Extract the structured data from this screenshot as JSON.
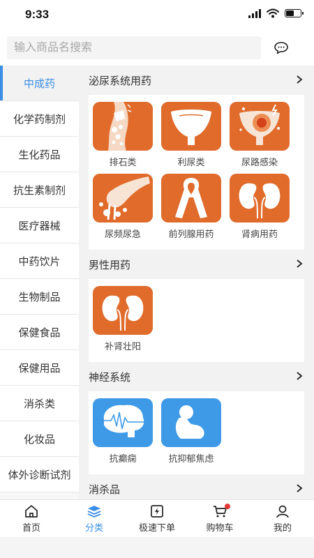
{
  "status": {
    "time": "9:33",
    "battery_level": 0.6
  },
  "search": {
    "placeholder": "输入商品名搜索",
    "value": ""
  },
  "header": {
    "message_icon": "chat-bubble-icon"
  },
  "sidebar": {
    "items": [
      {
        "label": "中成药",
        "active": true
      },
      {
        "label": "化学药制剂"
      },
      {
        "label": "生化药品"
      },
      {
        "label": "抗生素制剂"
      },
      {
        "label": "医疗器械"
      },
      {
        "label": "中药饮片"
      },
      {
        "label": "生物制品"
      },
      {
        "label": "保健食品"
      },
      {
        "label": "保健用品"
      },
      {
        "label": "消杀类"
      },
      {
        "label": "化妆品"
      },
      {
        "label": "体外诊断试剂"
      }
    ]
  },
  "sections": [
    {
      "title": "泌尿系统用药",
      "items": [
        {
          "label": "排石类",
          "icon": "kidney-stone-icon",
          "color": "#e06b2b"
        },
        {
          "label": "利尿类",
          "icon": "bladder-icon",
          "color": "#e06b2b"
        },
        {
          "label": "尿路感染",
          "icon": "bladder-infection-icon",
          "color": "#e06b2b"
        },
        {
          "label": "尿频尿急",
          "icon": "urine-splash-icon",
          "color": "#e06b2b"
        },
        {
          "label": "前列腺用药",
          "icon": "awareness-ribbon-icon",
          "color": "#e06b2b"
        },
        {
          "label": "肾病用药",
          "icon": "kidneys-icon",
          "color": "#e06b2b"
        }
      ]
    },
    {
      "title": "男性用药",
      "items": [
        {
          "label": "补肾壮阳",
          "icon": "kidneys-icon",
          "color": "#e06b2b"
        }
      ]
    },
    {
      "title": "神经系统",
      "items": [
        {
          "label": "抗癫痫",
          "icon": "brain-wave-icon",
          "color": "#3e9ae6"
        },
        {
          "label": "抗抑郁焦虑",
          "icon": "sad-person-icon",
          "color": "#3e9ae6"
        }
      ]
    },
    {
      "title": "消杀品",
      "items": []
    }
  ],
  "tabbar": {
    "items": [
      {
        "label": "首页",
        "icon": "home-icon"
      },
      {
        "label": "分类",
        "icon": "layers-icon",
        "active": true
      },
      {
        "label": "极速下单",
        "icon": "quick-order-icon"
      },
      {
        "label": "购物车",
        "icon": "cart-icon",
        "badge": true
      },
      {
        "label": "我的",
        "icon": "user-icon"
      }
    ]
  },
  "colors": {
    "accent": "#3a8ee6",
    "orange": "#e06b2b",
    "blue": "#3e9ae6",
    "badge": "#e53935"
  }
}
